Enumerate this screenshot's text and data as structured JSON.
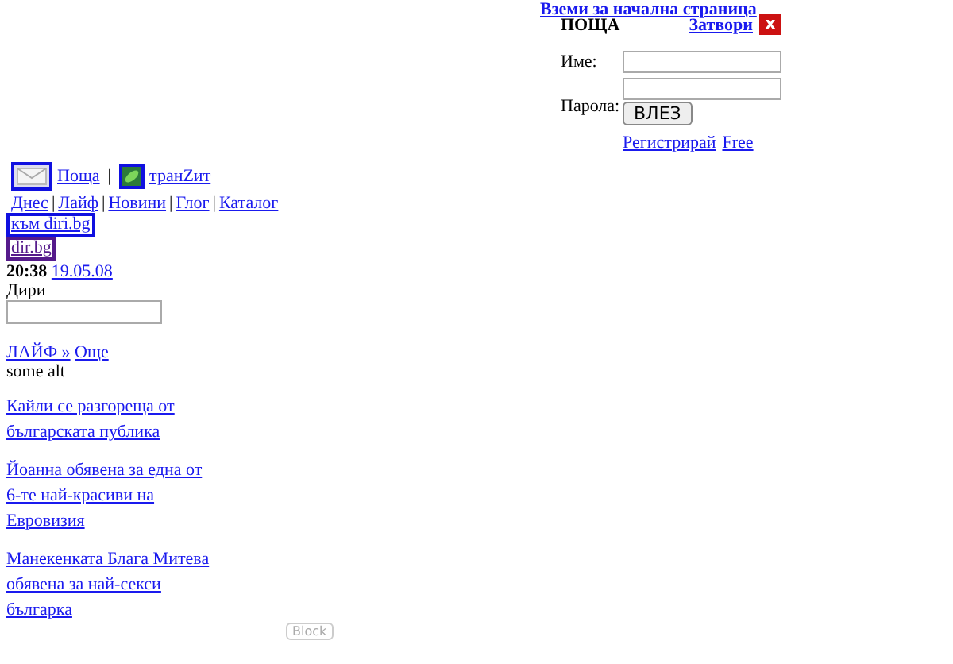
{
  "login_panel": {
    "homepage_link": "Вземи за начална страница",
    "title": "ПОЩА",
    "close_link": "Затвори",
    "close_button": "x",
    "name_label": "Име:",
    "password_label": "Парола:",
    "submit": "ВЛЕЗ",
    "links": [
      "Регистрирай",
      "Free"
    ]
  },
  "services": [
    {
      "label": "Поща",
      "kind": "mail"
    },
    {
      "label": "транZит",
      "kind": "leaf"
    }
  ],
  "nav": [
    "Днес",
    "Лайф",
    "Новини",
    "Глог",
    "Каталог"
  ],
  "boxed_links": [
    {
      "label": "към diri.bg",
      "visited": false
    },
    {
      "label": "dir.bg",
      "visited": true
    }
  ],
  "time": "20:38",
  "date": "19.05.08",
  "search_label": "Дири",
  "section": {
    "title": "ЛАЙФ »",
    "more": "Още",
    "alt": "some alt"
  },
  "articles": [
    "Кайли се разгореща от българската публика",
    "Йоанна обявена за една от 6-те най-красиви на Евровизия",
    "Манекенката Блага Митева обявена за най-секси българка"
  ],
  "block_button": "Block",
  "separator": "|"
}
